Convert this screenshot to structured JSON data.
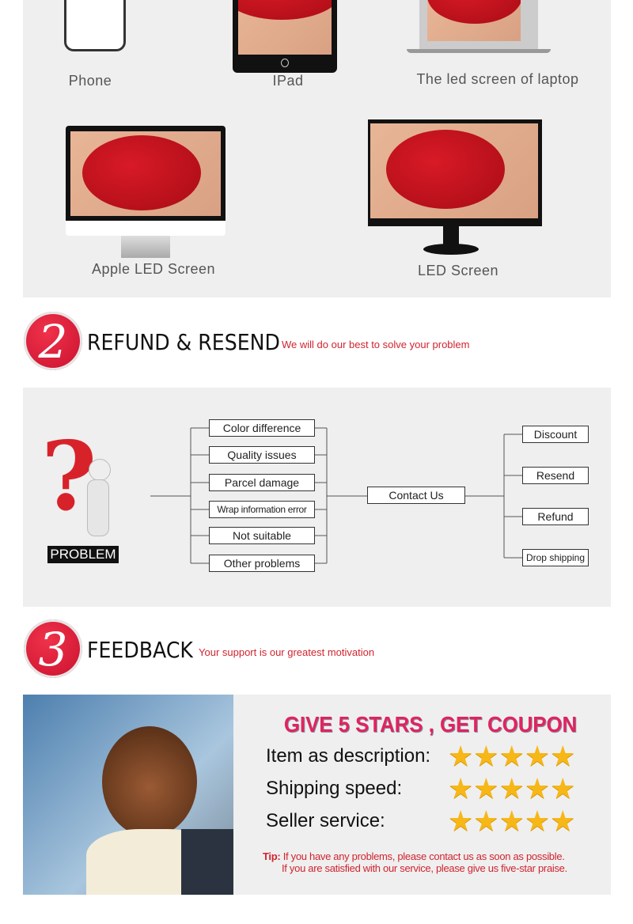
{
  "devices": {
    "phone": "Phone",
    "ipad": "IPad",
    "laptop": "The led screen of laptop",
    "apple": "Apple LED Screen",
    "led": "LED Screen"
  },
  "section2": {
    "number": "2",
    "title": "REFUND & RESEND",
    "subtitle": "We will do our best to solve your problem"
  },
  "diagram": {
    "problem_label": "PROBLEM",
    "problems": [
      "Color difference",
      "Quality issues",
      "Parcel damage",
      "Wrap information error",
      "Not suitable",
      "Other problems"
    ],
    "contact": "Contact Us",
    "solutions": [
      "Discount",
      "Resend",
      "Refund",
      "Drop shipping"
    ]
  },
  "section3": {
    "number": "3",
    "title": "FEEDBACK",
    "subtitle": "Your support is our greatest motivation"
  },
  "feedback": {
    "headline": "GIVE 5 STARS , GET COUPON",
    "ratings": [
      {
        "label": "Item as description:",
        "stars": 5
      },
      {
        "label": "Shipping speed:",
        "stars": 5
      },
      {
        "label": "Seller service:",
        "stars": 5
      }
    ],
    "tip_label": "Tip:",
    "tip_line1": "If you have any problems, please contact us as soon as possible.",
    "tip_line2": "If you are satisfied with our service, please give us five-star praise."
  },
  "colors": {
    "accent": "#d0242f",
    "headline": "#e0245e",
    "star": "#f7b717",
    "panel": "#efefef"
  }
}
